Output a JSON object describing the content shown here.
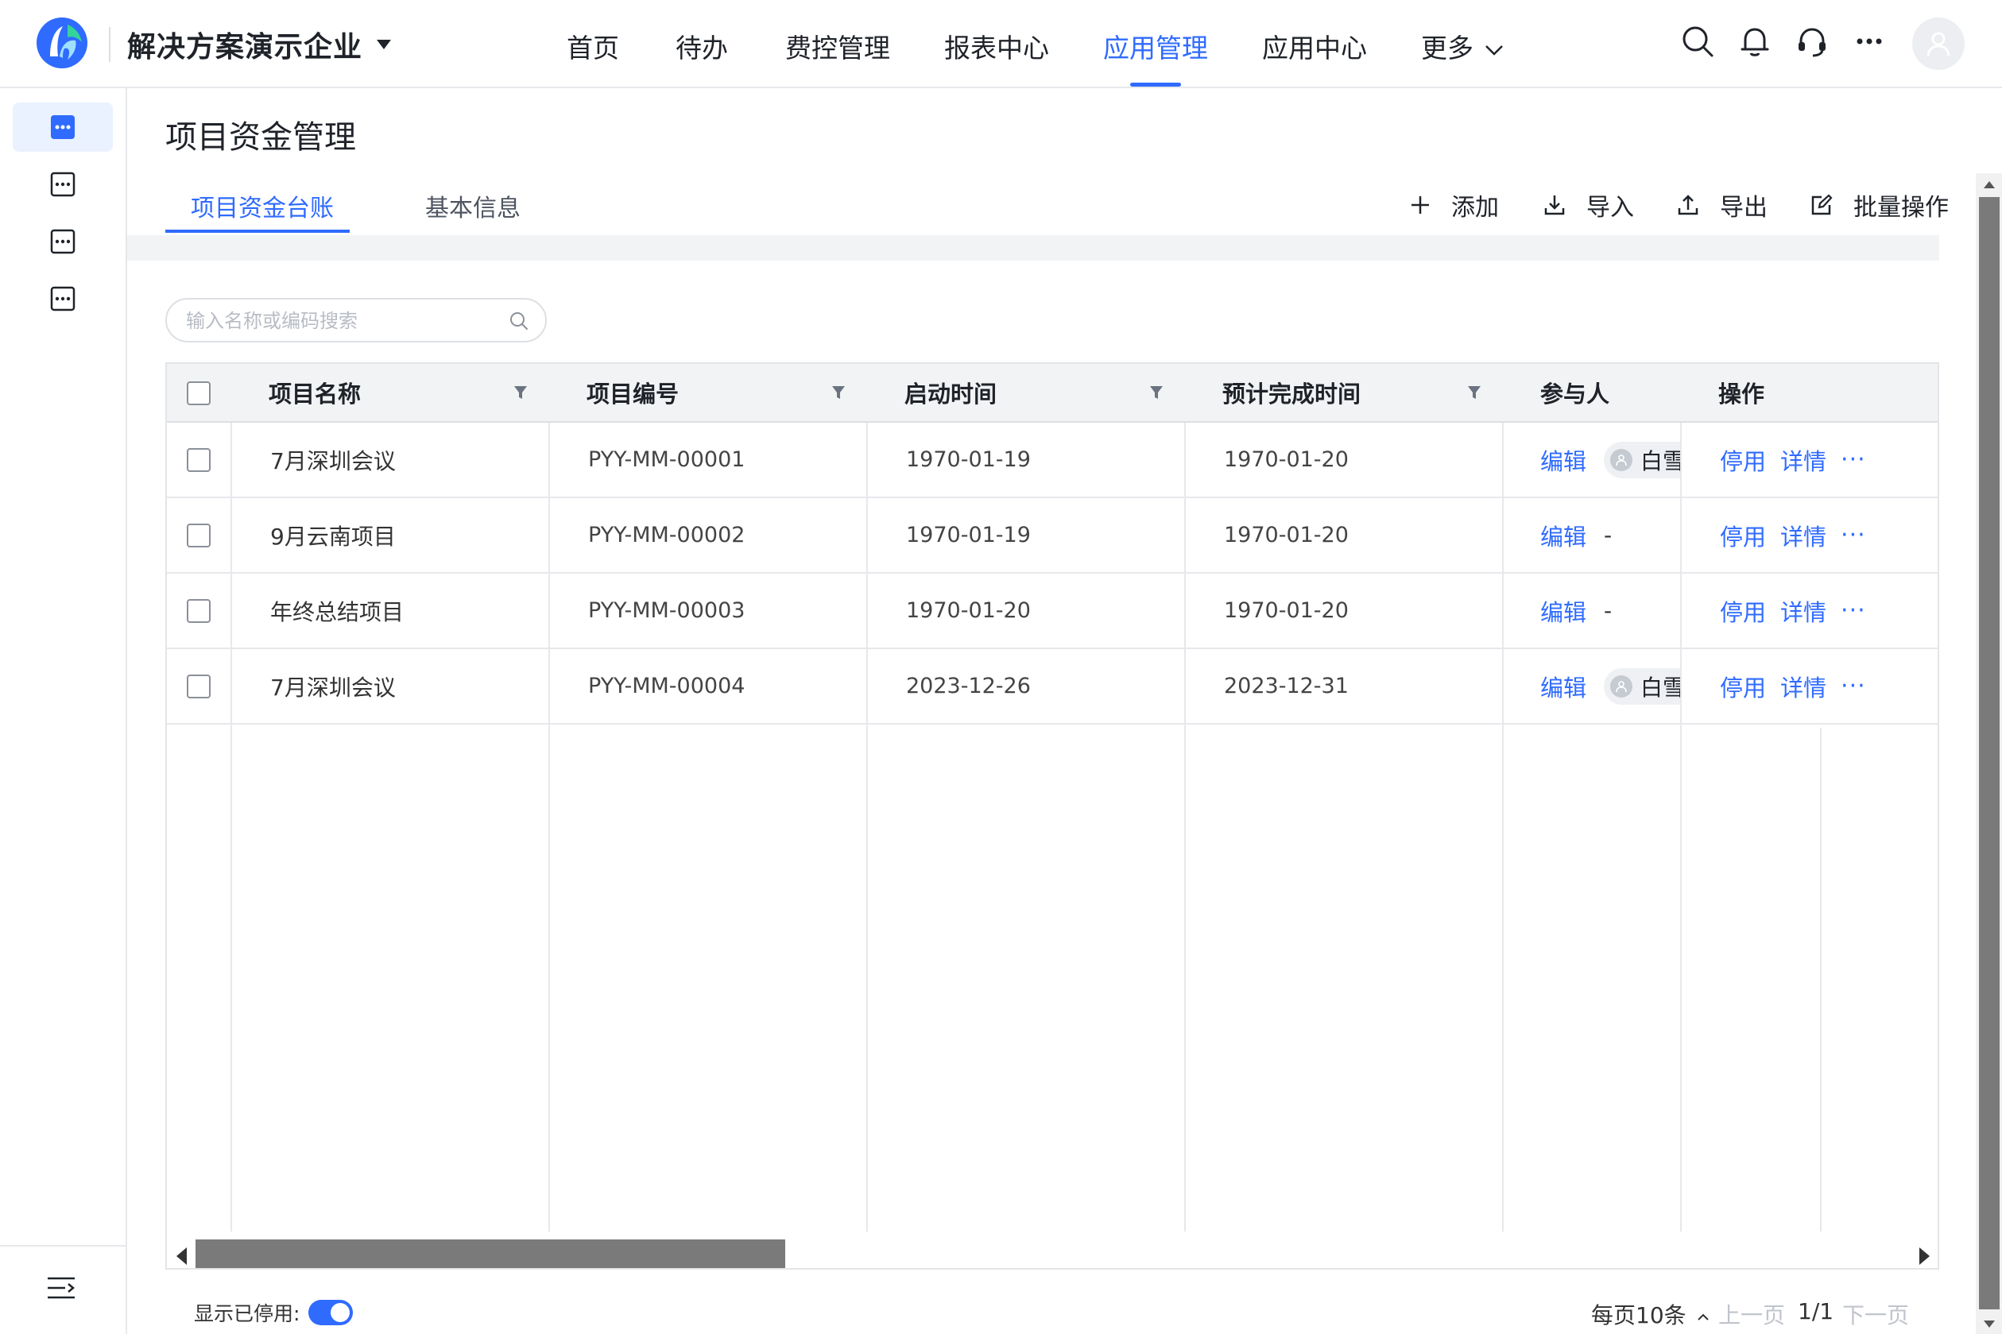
{
  "header": {
    "company_name": "解决方案演示企业",
    "nav": [
      {
        "label": "首页",
        "active": false
      },
      {
        "label": "待办",
        "active": false
      },
      {
        "label": "费控管理",
        "active": false
      },
      {
        "label": "报表中心",
        "active": false
      },
      {
        "label": "应用管理",
        "active": true
      },
      {
        "label": "应用中心",
        "active": false
      },
      {
        "label": "更多",
        "active": false
      }
    ],
    "icons": [
      "search-icon",
      "bell-icon",
      "headset-icon",
      "more-icon",
      "user-avatar-icon"
    ]
  },
  "sidebar": {
    "items": [
      {
        "icon": "app-icon",
        "active": true
      },
      {
        "icon": "app-icon",
        "active": false
      },
      {
        "icon": "app-icon",
        "active": false
      },
      {
        "icon": "app-icon",
        "active": false
      }
    ],
    "collapse_icon": "collapse-menu-icon"
  },
  "page": {
    "title": "项目资金管理",
    "tabs": [
      {
        "label": "项目资金台账",
        "active": true
      },
      {
        "label": "基本信息",
        "active": false
      }
    ],
    "toolbar": {
      "add": "添加",
      "import": "导入",
      "export": "导出",
      "batch": "批量操作"
    },
    "search": {
      "placeholder": "输入名称或编码搜索",
      "value": ""
    }
  },
  "table": {
    "columns": {
      "name": "项目名称",
      "code": "项目编号",
      "start": "启动时间",
      "end": "预计完成时间",
      "participants": "参与人",
      "actions": "操作"
    },
    "rows": [
      {
        "name": "7月深圳会议",
        "code": "PYY-MM-00001",
        "start": "1970-01-19",
        "end": "1970-01-20",
        "edit": "编辑",
        "participant": "白雪",
        "disable": "停用",
        "detail": "详情",
        "more": "···"
      },
      {
        "name": "9月云南项目",
        "code": "PYY-MM-00002",
        "start": "1970-01-19",
        "end": "1970-01-20",
        "edit": "编辑",
        "participant": "-",
        "disable": "停用",
        "detail": "详情",
        "more": "···"
      },
      {
        "name": "年终总结项目",
        "code": "PYY-MM-00003",
        "start": "1970-01-20",
        "end": "1970-01-20",
        "edit": "编辑",
        "participant": "-",
        "disable": "停用",
        "detail": "详情",
        "more": "···"
      },
      {
        "name": "7月深圳会议",
        "code": "PYY-MM-00004",
        "start": "2023-12-26",
        "end": "2023-12-31",
        "edit": "编辑",
        "participant": "白雪",
        "disable": "停用",
        "detail": "详情",
        "more": "···"
      }
    ]
  },
  "footer": {
    "show_disabled_label": "显示已停用:",
    "show_disabled_on": true,
    "page_size": "每页10条",
    "prev": "上一页",
    "page_indicator": "1/1",
    "next": "下一页"
  },
  "colors": {
    "accent": "#2f6bff",
    "header_bg": "#f2f3f5",
    "border": "#e6e8eb"
  }
}
